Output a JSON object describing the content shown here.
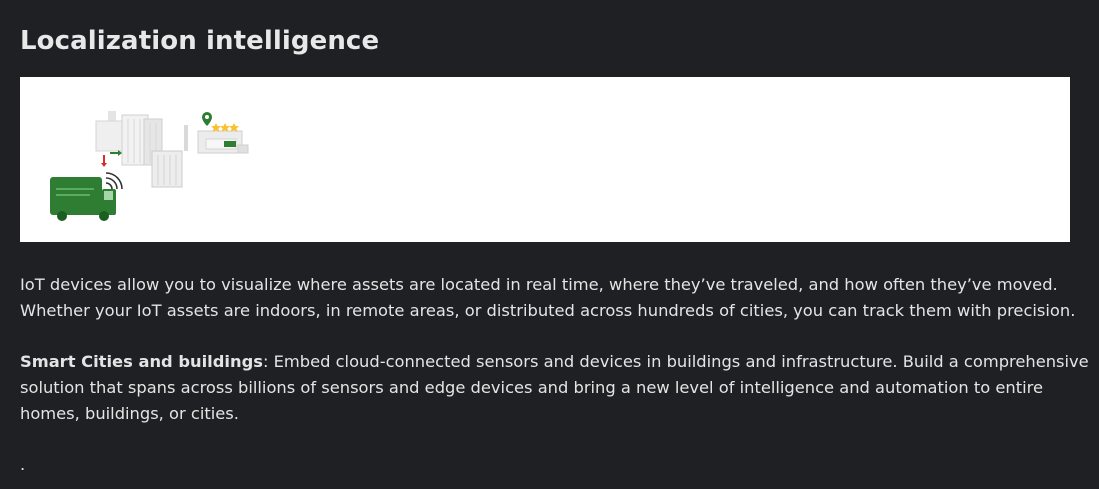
{
  "section": {
    "title": "Localization intelligence"
  },
  "illustration": {
    "truck_color": "#2e7d32",
    "icons": [
      "truck-icon",
      "wireless-signal-icon",
      "building-icon",
      "location-pin-icon",
      "star-rating-icon"
    ]
  },
  "content": {
    "paragraph_1": "IoT devices allow you to visualize where assets are located in real time, where they’ve traveled, and how often they’ve moved. Whether your IoT assets are indoors, in remote areas, or distributed across hundreds of cities, you can track them with precision.",
    "paragraph_2_bold": "Smart Cities and buildings",
    "paragraph_2_rest": ": Embed cloud-connected sensors and devices in buildings and infrastructure. Build a comprehensive solution that spans across billions of sensors and edge devices and bring a new level of intelligence and automation to entire homes, buildings, or cities.",
    "paragraph_3": "."
  }
}
